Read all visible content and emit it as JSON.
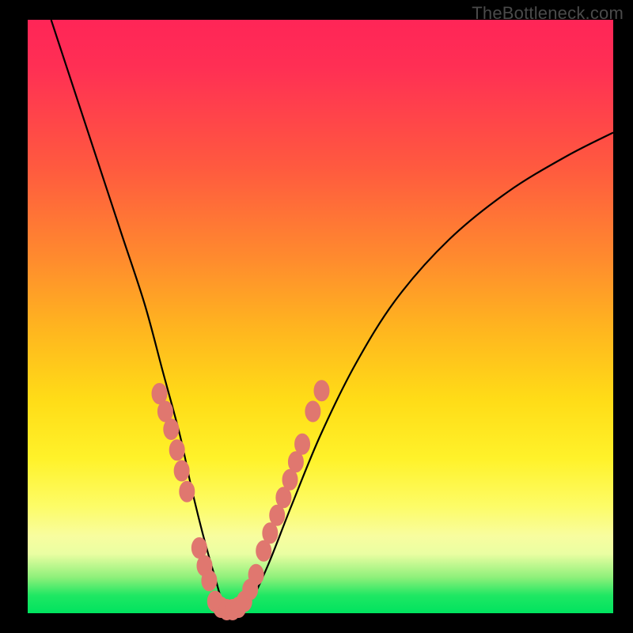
{
  "watermark": "TheBottleneck.com",
  "gradient_colors": {
    "top": "#ff2557",
    "mid_orange": "#ff8a2e",
    "mid_yellow": "#ffdc17",
    "light_yellow": "#fdfc67",
    "green": "#00e35f"
  },
  "curve_color": "#000000",
  "bead_color": "#e0776f",
  "chart_data": {
    "type": "line",
    "title": "",
    "xlabel": "",
    "ylabel": "",
    "xlim": [
      0,
      100
    ],
    "ylim": [
      0,
      100
    ],
    "series": [
      {
        "name": "bottleneck-curve",
        "x": [
          4,
          8,
          12,
          16,
          20,
          23,
          26,
          28,
          30,
          32,
          33.5,
          35.5,
          38,
          41,
          45,
          50,
          56,
          63,
          72,
          82,
          92,
          100
        ],
        "y": [
          100,
          88,
          76,
          64,
          52,
          41,
          30,
          21,
          13,
          6,
          1.5,
          0.5,
          2,
          8,
          18,
          30,
          42,
          53,
          63,
          71,
          77,
          81
        ]
      }
    ],
    "bead_segments": [
      {
        "x": [
          22.5,
          23.5,
          24.5,
          25.5,
          26.3,
          27.2
        ],
        "y": [
          37,
          34,
          31,
          27.5,
          24,
          20.5
        ]
      },
      {
        "x": [
          29.3,
          30.2,
          31.0
        ],
        "y": [
          11,
          8,
          5.5
        ]
      },
      {
        "x": [
          32.0,
          33.0,
          34.0,
          35.0,
          36.0,
          37.0
        ],
        "y": [
          2.0,
          1.0,
          0.6,
          0.6,
          1.0,
          2.0
        ]
      },
      {
        "x": [
          38.0,
          39.0
        ],
        "y": [
          4.0,
          6.5
        ]
      },
      {
        "x": [
          40.3,
          41.4,
          42.6,
          43.7,
          44.8,
          45.8,
          46.9
        ],
        "y": [
          10.5,
          13.5,
          16.5,
          19.5,
          22.5,
          25.5,
          28.5
        ]
      },
      {
        "x": [
          48.7,
          50.2
        ],
        "y": [
          34,
          37.5
        ]
      }
    ]
  }
}
